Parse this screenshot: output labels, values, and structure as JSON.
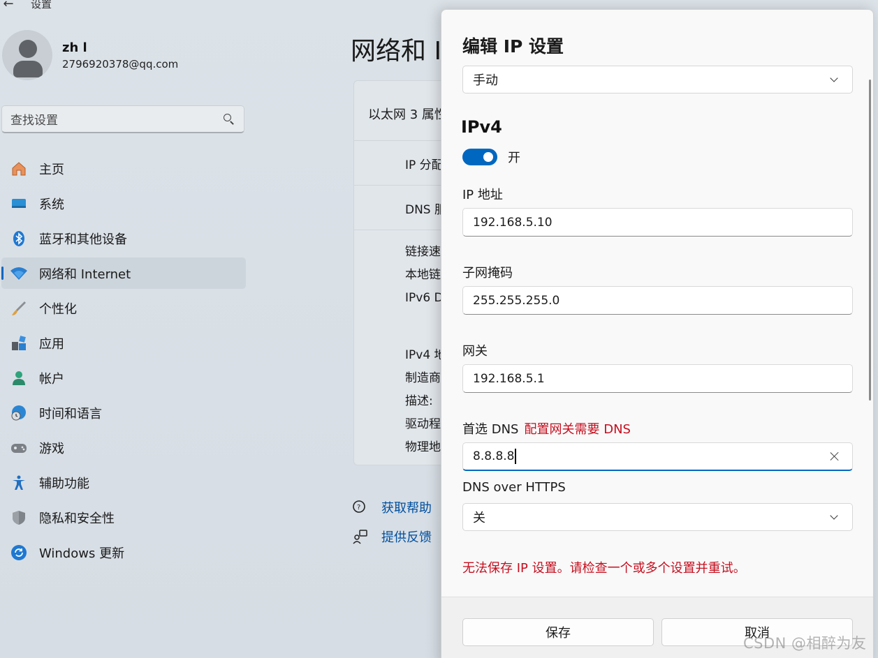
{
  "window": {
    "back_glyph": "←",
    "title": "设置"
  },
  "profile": {
    "name": "zh l",
    "email": "2796920378@qq.com"
  },
  "search": {
    "placeholder": "查找设置"
  },
  "nav": {
    "items": [
      {
        "label": "主页",
        "icon": "home-icon",
        "glyph": "🏠",
        "active": false
      },
      {
        "label": "系统",
        "icon": "system-icon",
        "glyph": "▬",
        "active": false
      },
      {
        "label": "蓝牙和其他设备",
        "icon": "bluetooth-icon",
        "glyph": "ᛒ",
        "active": false
      },
      {
        "label": "网络和 Internet",
        "icon": "wifi-icon",
        "glyph": "◆",
        "active": true
      },
      {
        "label": "个性化",
        "icon": "brush-icon",
        "glyph": "🖌",
        "active": false
      },
      {
        "label": "应用",
        "icon": "apps-icon",
        "glyph": "▚",
        "active": false
      },
      {
        "label": "帐户",
        "icon": "account-icon",
        "glyph": "👤",
        "active": false
      },
      {
        "label": "时间和语言",
        "icon": "globe-clock-icon",
        "glyph": "🌐",
        "active": false
      },
      {
        "label": "游戏",
        "icon": "gamepad-icon",
        "glyph": "🎮",
        "active": false
      },
      {
        "label": "辅助功能",
        "icon": "accessibility-icon",
        "glyph": "🯅",
        "active": false
      },
      {
        "label": "隐私和安全性",
        "icon": "shield-icon",
        "glyph": "⛉",
        "active": false
      },
      {
        "label": "Windows 更新",
        "icon": "update-icon",
        "glyph": "⟳",
        "active": false
      }
    ]
  },
  "page": {
    "title": "网络和 I"
  },
  "card": {
    "header": "以太网 3 属性",
    "rows": [
      "IP 分配",
      "DNS 服"
    ],
    "details_a": [
      "链接速",
      "本地链",
      "IPv6 D"
    ],
    "details_b": [
      "IPv4 地",
      "制造商",
      "描述:",
      "驱动程",
      "物理地"
    ]
  },
  "help": {
    "get_help": "获取帮助",
    "feedback": "提供反馈"
  },
  "dialog": {
    "title": "编辑 IP 设置",
    "mode_select": "手动",
    "ipv4_heading": "IPv4",
    "ipv4_toggle": "开",
    "ip_label": "IP 地址",
    "ip_value": "192.168.5.10",
    "subnet_label": "子网掩码",
    "subnet_value": "255.255.255.0",
    "gateway_label": "网关",
    "gateway_value": "192.168.5.1",
    "dns_label": "首选 DNS",
    "dns_error": "配置网关需要 DNS",
    "dns_value": "8.8.8.8",
    "doh_label": "DNS over HTTPS",
    "doh_value": "关",
    "error_message": "无法保存 IP 设置。请检查一个或多个设置并重试。",
    "save_label": "保存",
    "cancel_label": "取消"
  },
  "watermark": "CSDN @相醉为友",
  "colors": {
    "accent": "#0067c0",
    "error": "#c50f1f",
    "link": "#004f9f"
  }
}
